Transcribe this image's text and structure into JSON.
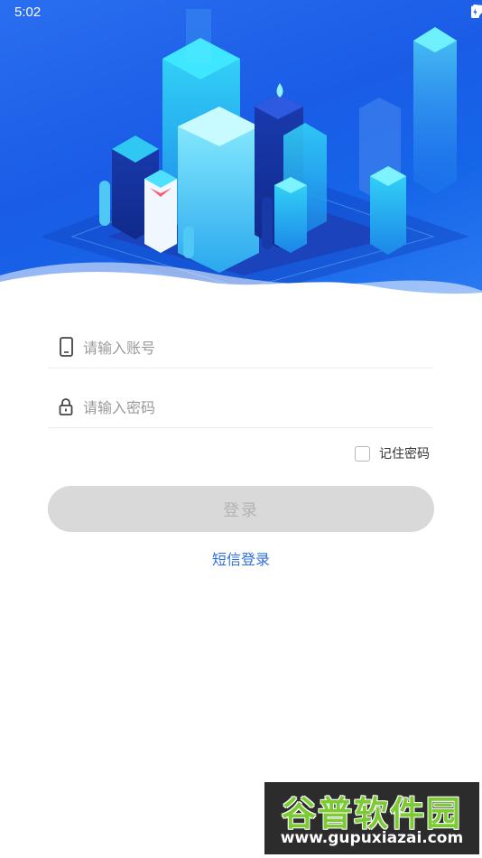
{
  "status_bar": {
    "time": "5:02",
    "icons": [
      "wifi-icon",
      "battery-charging-icon"
    ]
  },
  "hero": {
    "illustration": "isometric-city-illustration",
    "colors": {
      "background": "#1a5ce6",
      "accent_cyan": "#2ed3f5"
    }
  },
  "form": {
    "account": {
      "placeholder": "请输入账号",
      "icon": "phone-icon"
    },
    "password": {
      "placeholder": "请输入密码",
      "icon": "lock-icon"
    },
    "remember_label": "记住密码",
    "remember_checked": false,
    "login_label": "登录",
    "sms_login_label": "短信登录"
  },
  "watermark": {
    "title": "谷普软件园",
    "url": "www.gupuxiazai.com"
  },
  "colors": {
    "link": "#2f6fe0",
    "button_disabled_bg": "#d9d9d9",
    "button_disabled_text": "#b3b3b3"
  }
}
